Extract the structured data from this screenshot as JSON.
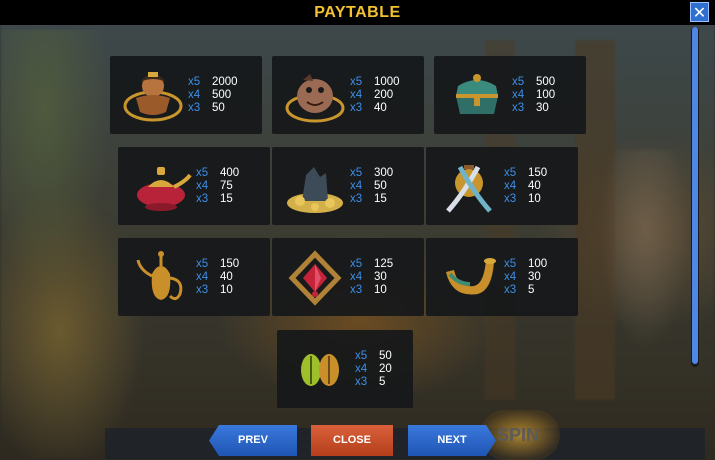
{
  "title": "PAYTABLE",
  "close_glyph": "✕",
  "buttons": {
    "prev": "PREV",
    "close": "CLOSE",
    "next": "NEXT"
  },
  "background_spin_label": "SPIN",
  "symbols": [
    {
      "icon": "genie-icon",
      "pays": [
        {
          "mult": "x5",
          "value": "2000"
        },
        {
          "mult": "x4",
          "value": "500"
        },
        {
          "mult": "x3",
          "value": "50"
        }
      ]
    },
    {
      "icon": "monster-icon",
      "pays": [
        {
          "mult": "x5",
          "value": "1000"
        },
        {
          "mult": "x4",
          "value": "200"
        },
        {
          "mult": "x3",
          "value": "40"
        }
      ]
    },
    {
      "icon": "treasure-chest-icon",
      "pays": [
        {
          "mult": "x5",
          "value": "500"
        },
        {
          "mult": "x4",
          "value": "100"
        },
        {
          "mult": "x3",
          "value": "30"
        }
      ]
    },
    {
      "icon": "magic-lamp-icon",
      "pays": [
        {
          "mult": "x5",
          "value": "400"
        },
        {
          "mult": "x4",
          "value": "75"
        },
        {
          "mult": "x3",
          "value": "15"
        }
      ]
    },
    {
      "icon": "gold-pile-icon",
      "pays": [
        {
          "mult": "x5",
          "value": "300"
        },
        {
          "mult": "x4",
          "value": "50"
        },
        {
          "mult": "x3",
          "value": "15"
        }
      ]
    },
    {
      "icon": "swords-icon",
      "pays": [
        {
          "mult": "x5",
          "value": "150"
        },
        {
          "mult": "x4",
          "value": "40"
        },
        {
          "mult": "x3",
          "value": "10"
        }
      ]
    },
    {
      "icon": "golden-pitcher-icon",
      "pays": [
        {
          "mult": "x5",
          "value": "150"
        },
        {
          "mult": "x4",
          "value": "40"
        },
        {
          "mult": "x3",
          "value": "10"
        }
      ]
    },
    {
      "icon": "ruby-amulet-icon",
      "pays": [
        {
          "mult": "x5",
          "value": "125"
        },
        {
          "mult": "x4",
          "value": "30"
        },
        {
          "mult": "x3",
          "value": "10"
        }
      ]
    },
    {
      "icon": "golden-horn-icon",
      "pays": [
        {
          "mult": "x5",
          "value": "100"
        },
        {
          "mult": "x4",
          "value": "30"
        },
        {
          "mult": "x3",
          "value": "5"
        }
      ]
    },
    {
      "icon": "scarab-icon",
      "pays": [
        {
          "mult": "x5",
          "value": "50"
        },
        {
          "mult": "x4",
          "value": "20"
        },
        {
          "mult": "x3",
          "value": "5"
        }
      ]
    }
  ],
  "colors": {
    "title": "#f2c230",
    "multiplier": "#3d8fe8",
    "value": "#ffffff",
    "card": "#16181a",
    "nav_button": "#2a66c8",
    "close_button": "#c84c26"
  }
}
